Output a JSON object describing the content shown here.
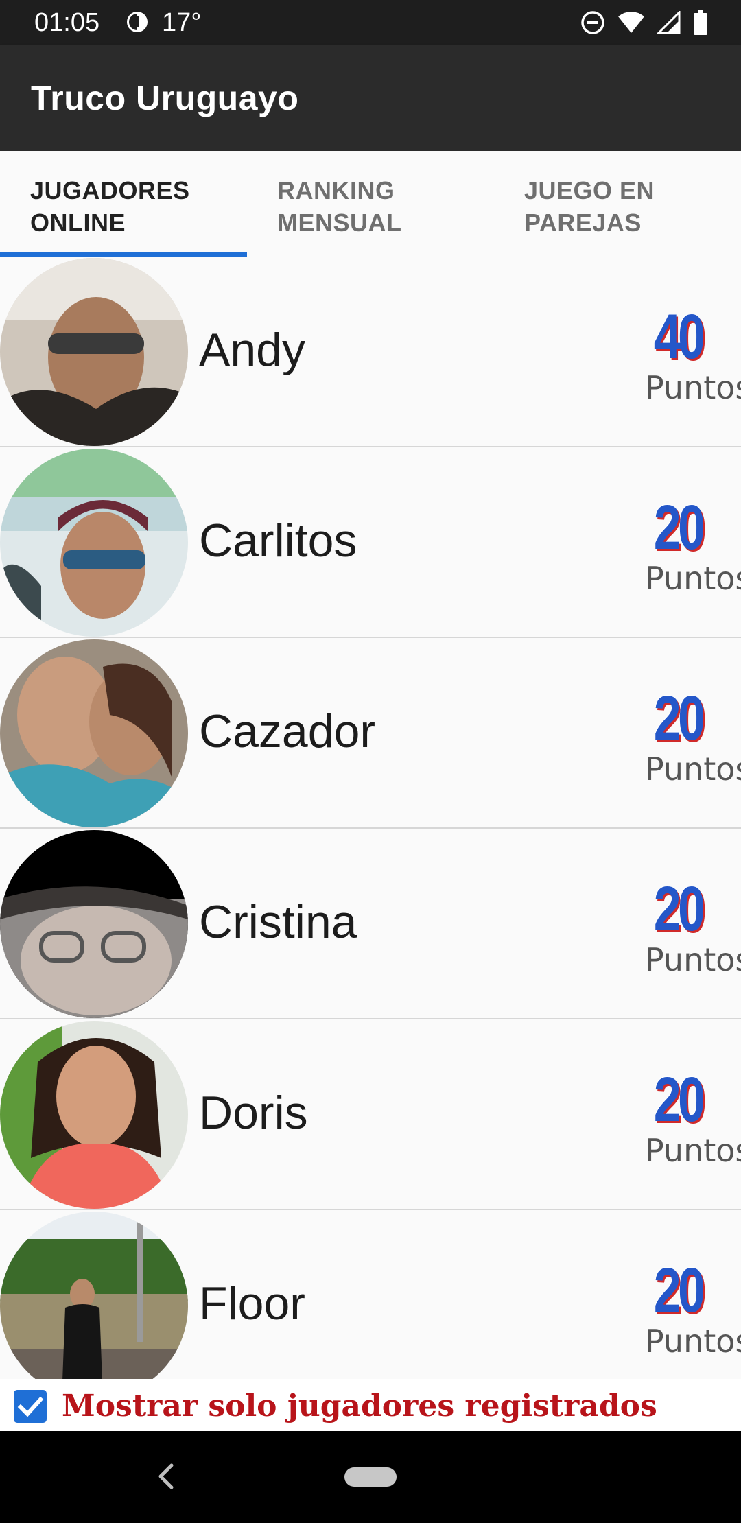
{
  "status_bar": {
    "time": "01:05",
    "temperature": "17°",
    "icons": [
      "weather-icon",
      "do-not-disturb-icon",
      "wifi-icon",
      "cell-signal-icon",
      "battery-icon"
    ]
  },
  "app_bar": {
    "title": "Truco Uruguayo"
  },
  "tabs": [
    {
      "label": "JUGADORES\nONLINE",
      "active": true
    },
    {
      "label": "RANKING\nMENSUAL",
      "active": false
    },
    {
      "label": "JUEGO EN\nPAREJAS",
      "active": false
    }
  ],
  "players": [
    {
      "name": "Andy",
      "points": "40",
      "points_label": "Puntos"
    },
    {
      "name": "Carlitos",
      "points": "20",
      "points_label": "Puntos"
    },
    {
      "name": "Cazador",
      "points": "20",
      "points_label": "Puntos"
    },
    {
      "name": "Cristina",
      "points": "20",
      "points_label": "Puntos"
    },
    {
      "name": "Doris",
      "points": "20",
      "points_label": "Puntos"
    },
    {
      "name": "Floor",
      "points": "20",
      "points_label": "Puntos"
    }
  ],
  "footer": {
    "checkbox_checked": true,
    "checkbox_label": "Mostrar solo jugadores registrados"
  },
  "colors": {
    "accent": "#1f6fd6",
    "app_bar": "#2b2b2b",
    "status_bar": "#1e1e1e",
    "footer_text": "#b8141a",
    "points_blue": "#2457c9",
    "points_red": "#d02a2a"
  },
  "nav_bar": {
    "icons": [
      "back-icon",
      "home-pill-icon"
    ]
  }
}
